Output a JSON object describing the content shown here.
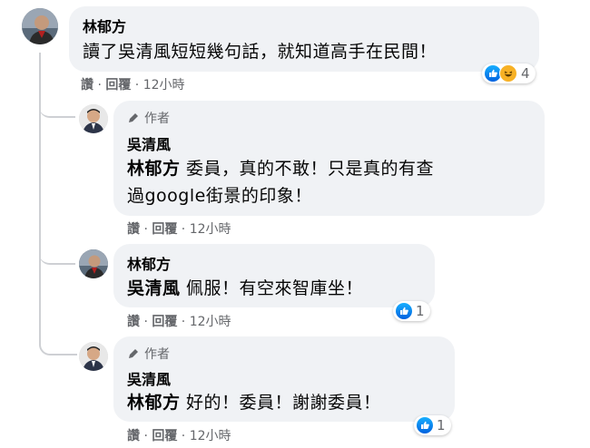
{
  "comments": [
    {
      "name": "林郁方",
      "text": "讀了吳清風短短幾句話，就知道高手在民間！",
      "reaction_count": "4",
      "meta": {
        "like": "讚",
        "reply": "回覆",
        "time": "12小時"
      }
    }
  ],
  "replies": [
    {
      "author_tag": "作者",
      "name": "吳清風",
      "mention": "林郁方",
      "text_line1": " 委員，真的不敢！只是真的有查",
      "text_line2": "過google街景的印象！",
      "meta": {
        "like": "讚",
        "reply": "回覆",
        "time": "12小時"
      }
    },
    {
      "name": "林郁方",
      "mention": "吳清風",
      "text": " 佩服！有空來智庫坐！",
      "reaction_count": "1",
      "meta": {
        "like": "讚",
        "reply": "回覆",
        "time": "12小時"
      }
    },
    {
      "author_tag": "作者",
      "name": "吳清風",
      "mention": "林郁方",
      "text": " 好的！委員！謝謝委員！",
      "reaction_count": "1",
      "meta": {
        "like": "讚",
        "reply": "回覆",
        "time": "12小時"
      }
    }
  ],
  "separator": " · ",
  "colors": {
    "bubble": "#f0f2f5",
    "meta": "#65676b",
    "like": "#1877f2",
    "haha": "#f7b125"
  }
}
